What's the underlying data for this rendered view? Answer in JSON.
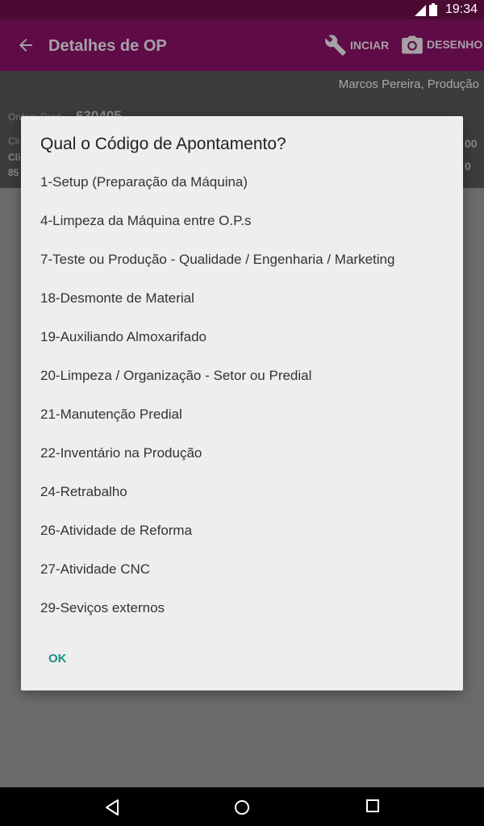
{
  "status_bar": {
    "time": "19:34"
  },
  "app_bar": {
    "title": "Detalhes de OP",
    "actions": [
      {
        "label": "INCIAR",
        "icon": "wrench-icon"
      },
      {
        "label": "DESENHO",
        "icon": "camera-icon"
      }
    ]
  },
  "info": {
    "user": "Marcos Pereira, Produção",
    "op_label": "Ordem Prod.",
    "op_value": "630405",
    "client_label": "Cli",
    "client_label2": "Cli",
    "num": "85",
    "right_top": "00",
    "right_bottom": "0"
  },
  "dialog": {
    "title": "Qual o Código de Apontamento?",
    "options": [
      "1-Setup (Preparação da Máquina)",
      "4-Limpeza da Máquina entre O.P.s",
      "7-Teste ou Produção - Qualidade / Engenharia / Marketing",
      "18-Desmonte de Material",
      "19-Auxiliando Almoxarifado",
      "20-Limpeza / Organização - Setor ou Predial",
      "21-Manutenção Predial",
      "22-Inventário na Produção",
      "24-Retrabalho",
      "26-Atividade de Reforma",
      "27-Atividade CNC",
      "29-Seviços externos"
    ],
    "ok_label": "OK"
  },
  "colors": {
    "accent": "#1a8f88",
    "app_bar": "#8a1167",
    "status_bar": "#6a0f4a"
  }
}
